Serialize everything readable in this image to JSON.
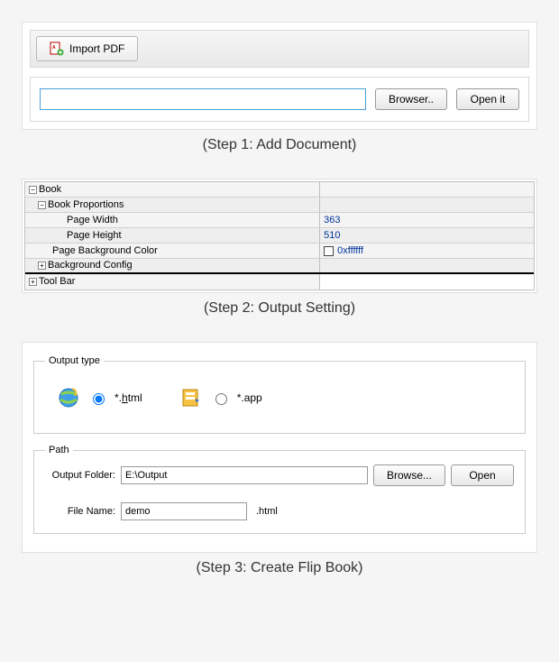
{
  "step1": {
    "import_btn_label": "Import PDF",
    "path_value": "",
    "browser_btn": "Browser..",
    "open_btn": "Open it",
    "caption": "(Step 1: Add Document)"
  },
  "step2": {
    "caption": "(Step 2: Output Setting)",
    "rows": {
      "book": "Book",
      "book_proportions": "Book Proportions",
      "page_width": "Page Width",
      "page_width_val": "363",
      "page_height": "Page Height",
      "page_height_val": "510",
      "page_bg_color": "Page Background Color",
      "page_bg_color_val": "0xffffff",
      "background_config": "Background Config",
      "tool_bar": "Tool Bar"
    }
  },
  "step3": {
    "caption": "(Step 3: Create Flip Book)",
    "output_type_legend": "Output type",
    "html_prefix": "*.",
    "html_key": "h",
    "html_suffix": "tml",
    "app_label": "*.app",
    "path_legend": "Path",
    "output_folder_label": "Output Folder:",
    "output_folder_value": "E:\\Output",
    "browse_btn": "Browse...",
    "open_btn": "Open",
    "file_name_label": "File Name:",
    "file_name_value": "demo",
    "ext_label": ".html"
  }
}
